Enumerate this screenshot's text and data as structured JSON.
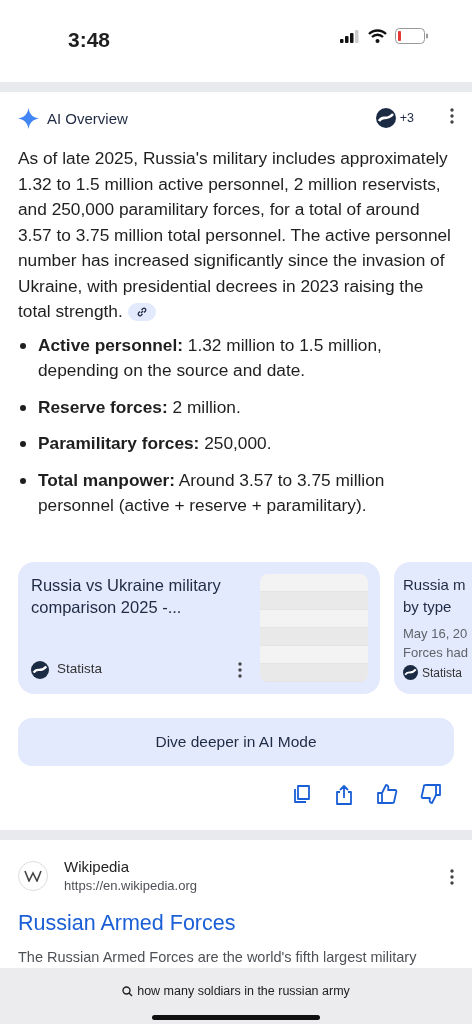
{
  "status_bar": {
    "time": "3:48"
  },
  "ai_overview": {
    "title": "AI Overview",
    "source_count": "+3",
    "paragraph": "As of late 2025, Russia's military includes approximately 1.32 to 1.5 million active personnel, 2 million reservists, and 250,000 paramilitary forces, for a total of around 3.57 to 3.75 million total personnel. The active personnel number has increased significantly since the invasion of Ukraine, with presidential decrees in 2023 raising the total strength.",
    "bullets": [
      {
        "text": "**Active personnel:** 1.32 million to 1.5 million, depending on the source and date."
      },
      {
        "text": "**Reserve forces:** 2 million."
      },
      {
        "text": "**Paramilitary forces:** 250,000."
      },
      {
        "text": "**Total manpower:** Around 3.57 to 3.75 million personnel (active + reserve + paramilitary)."
      }
    ],
    "sources": [
      {
        "title_lines": [
          "Russia vs Ukraine military",
          "comparison 2025 -..."
        ],
        "site": "Statista",
        "thumbnail": true
      },
      {
        "title_lines": [
          "Russia m",
          "by type"
        ],
        "date": "May 16, 20",
        "snippet": "Forces had",
        "site": "Statista",
        "thumbnail": false
      }
    ],
    "dive_button": "Dive deeper in AI Mode"
  },
  "result": {
    "site": "Wikipedia",
    "url": "https://en.wikipedia.org",
    "title": "Russian Armed Forces",
    "snippet": "The Russian Armed Forces are the world's fifth largest military"
  },
  "bottom_bar": {
    "query": "how many soldiars in the russian army"
  }
}
